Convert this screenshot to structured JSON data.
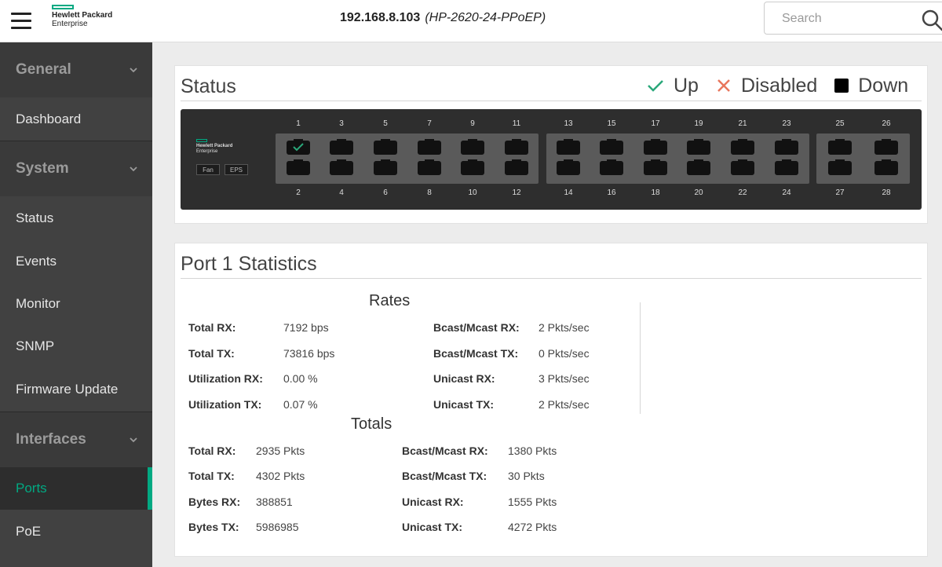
{
  "header": {
    "logo_line1": "Hewlett Packard",
    "logo_line2": "Enterprise",
    "ip": "192.168.8.103",
    "model": "(HP-2620-24-PPoEP)",
    "search_placeholder": "Search"
  },
  "sidebar": {
    "groups": [
      {
        "label": "General",
        "items": [
          "Dashboard"
        ]
      },
      {
        "label": "System",
        "items": [
          "Status",
          "Events",
          "Monitor",
          "SNMP",
          "Firmware Update"
        ]
      },
      {
        "label": "Interfaces",
        "items": [
          "Ports",
          "PoE"
        ]
      }
    ],
    "active_item": "Ports",
    "accent_color": "#01a982"
  },
  "status_panel": {
    "title": "Status",
    "legend": [
      {
        "label": "Up",
        "icon": "check-icon",
        "color": "#2aa87a"
      },
      {
        "label": "Disabled",
        "icon": "x-icon",
        "color": "#e8765c"
      },
      {
        "label": "Down",
        "icon": "square-icon",
        "color": "#000000"
      }
    ],
    "switch": {
      "logo_line1": "Hewlett Packard",
      "logo_line2": "Enterprise",
      "badges": [
        "Fan",
        "EPS"
      ],
      "top_ports": [
        "1",
        "3",
        "5",
        "7",
        "9",
        "11",
        "13",
        "15",
        "17",
        "19",
        "21",
        "23",
        "25",
        "26"
      ],
      "bottom_ports": [
        "2",
        "4",
        "6",
        "8",
        "10",
        "12",
        "14",
        "16",
        "18",
        "20",
        "22",
        "24",
        "27",
        "28"
      ],
      "up_ports": [
        "1"
      ]
    }
  },
  "stats_panel": {
    "title": "Port 1 Statistics",
    "rates": {
      "heading": "Rates",
      "left": [
        {
          "label": "Total RX:",
          "value": "7192 bps"
        },
        {
          "label": "Total TX:",
          "value": "73816 bps"
        },
        {
          "label": "Utilization RX:",
          "value": "0.00 %"
        },
        {
          "label": "Utilization TX:",
          "value": "0.07 %"
        }
      ],
      "right": [
        {
          "label": "Bcast/Mcast RX:",
          "value": "2 Pkts/sec"
        },
        {
          "label": "Bcast/Mcast TX:",
          "value": "0 Pkts/sec"
        },
        {
          "label": "Unicast RX:",
          "value": "3 Pkts/sec"
        },
        {
          "label": "Unicast TX:",
          "value": "2 Pkts/sec"
        }
      ]
    },
    "totals": {
      "heading": "Totals",
      "left": [
        {
          "label": "Total RX:",
          "value": "2935 Pkts"
        },
        {
          "label": "Total TX:",
          "value": "4302 Pkts"
        },
        {
          "label": "Bytes RX:",
          "value": "388851"
        },
        {
          "label": "Bytes TX:",
          "value": "5986985"
        }
      ],
      "right": [
        {
          "label": "Bcast/Mcast RX:",
          "value": "1380 Pkts"
        },
        {
          "label": "Bcast/Mcast TX:",
          "value": "30 Pkts"
        },
        {
          "label": "Unicast RX:",
          "value": "1555 Pkts"
        },
        {
          "label": "Unicast TX:",
          "value": "4272 Pkts"
        }
      ]
    }
  }
}
